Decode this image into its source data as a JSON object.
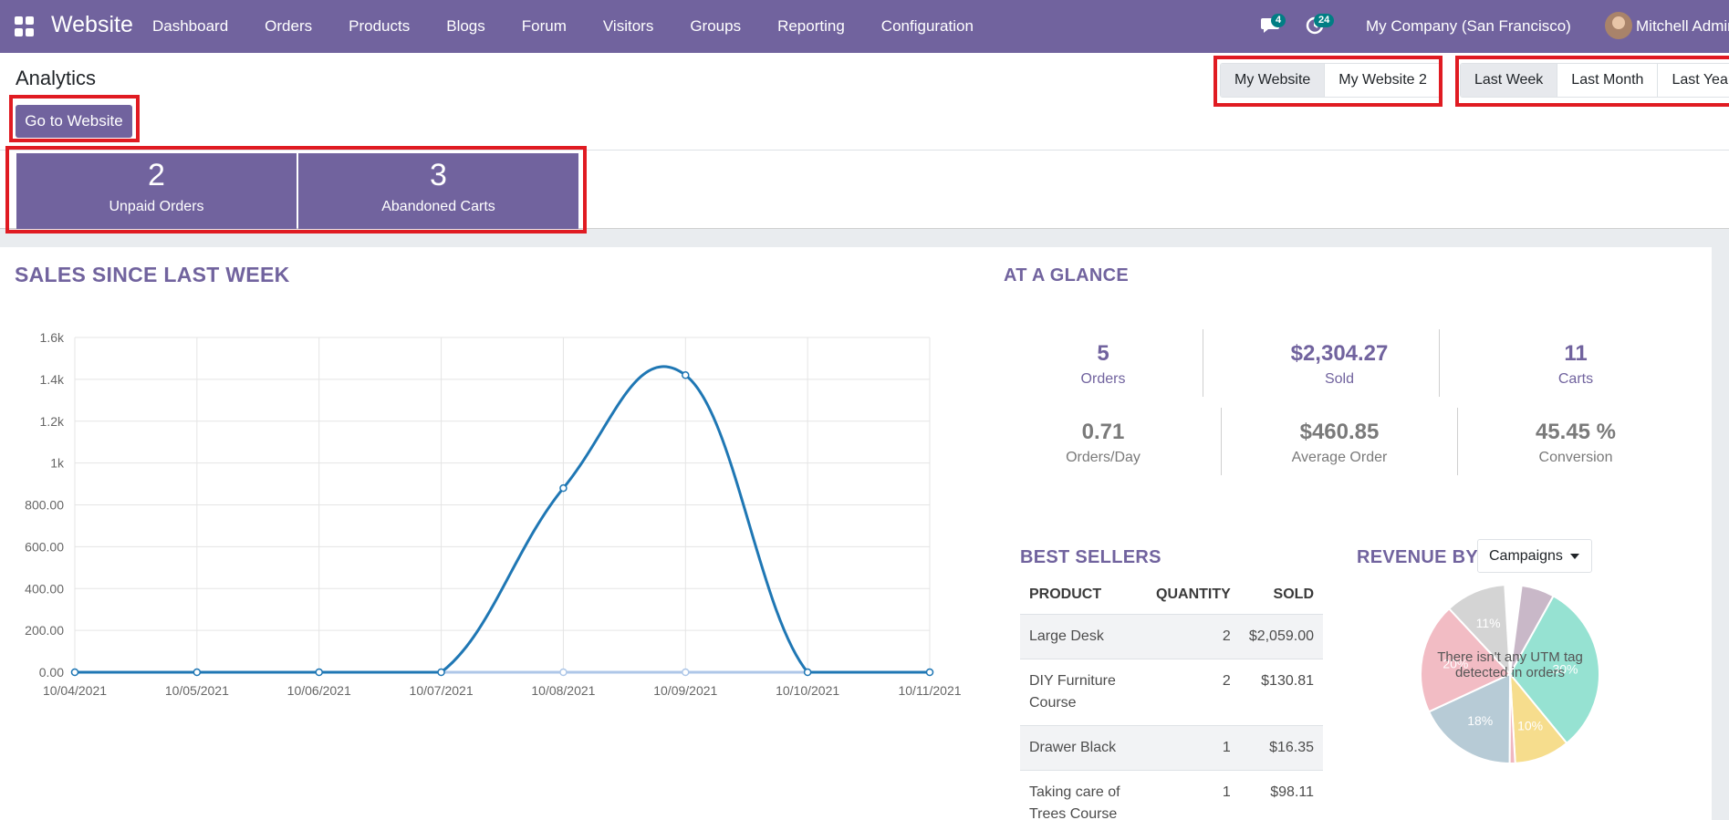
{
  "navbar": {
    "app_title": "Website",
    "menu": [
      "Dashboard",
      "Orders",
      "Products",
      "Blogs",
      "Forum",
      "Visitors",
      "Groups",
      "Reporting",
      "Configuration"
    ],
    "chat_count": "4",
    "activity_count": "24",
    "company": "My Company (San Francisco)",
    "user": "Mitchell Admin"
  },
  "control": {
    "title": "Analytics",
    "go_button": "Go to Website",
    "websites": [
      "My Website",
      "My Website 2"
    ],
    "active_website": "My Website",
    "periods": [
      "Last Week",
      "Last Month",
      "Last Year"
    ],
    "active_period": "Last Week"
  },
  "stats": {
    "unpaid_orders": {
      "value": "2",
      "label": "Unpaid Orders"
    },
    "abandoned_carts": {
      "value": "3",
      "label": "Abandoned Carts"
    }
  },
  "sales": {
    "title": "SALES SINCE LAST WEEK"
  },
  "chart_data": {
    "type": "line",
    "title": "",
    "x": [
      "10/04/2021",
      "10/05/2021",
      "10/06/2021",
      "10/07/2021",
      "10/08/2021",
      "10/09/2021",
      "10/10/2021",
      "10/11/2021"
    ],
    "series": [
      {
        "values": [
          0,
          0,
          0,
          0,
          880,
          1420,
          0,
          0
        ],
        "color": "#1f77b4"
      },
      {
        "values": [
          0,
          0,
          0,
          0,
          0,
          0,
          0,
          0
        ],
        "color": "#aec7e8"
      }
    ],
    "yticks": [
      "0.00",
      "200.00",
      "400.00",
      "600.00",
      "800.00",
      "1k",
      "1.2k",
      "1.4k",
      "1.6k"
    ],
    "ylim": [
      0,
      1600
    ],
    "grid": true
  },
  "glance": {
    "title": "AT A GLANCE",
    "kpis_top": [
      {
        "value": "5",
        "label": "Orders"
      },
      {
        "value": "$2,304.27",
        "label": "Sold"
      },
      {
        "value": "11",
        "label": "Carts"
      }
    ],
    "kpis_bottom": [
      {
        "value": "0.71",
        "label": "Orders/Day"
      },
      {
        "value": "$460.85",
        "label": "Average Order"
      },
      {
        "value": "45.45 %",
        "label": "Conversion"
      }
    ]
  },
  "best_sellers": {
    "title": "BEST SELLERS",
    "columns": [
      "PRODUCT",
      "QUANTITY",
      "SOLD"
    ],
    "rows": [
      [
        "Large Desk",
        "2",
        "$2,059.00"
      ],
      [
        "DIY Furniture Course",
        "2",
        "$130.81"
      ],
      [
        "Drawer Black",
        "1",
        "$16.35"
      ],
      [
        "Taking care of Trees Course",
        "1",
        "$98.11"
      ]
    ]
  },
  "revenue": {
    "title": "REVENUE BY",
    "selected": "Campaigns",
    "message": "There isn't any UTM tag detected in orders",
    "slices": [
      {
        "pct": 6,
        "color": "#c9b8c8",
        "label": ""
      },
      {
        "pct": 31,
        "color": "#96e2d2",
        "label": "30%"
      },
      {
        "pct": 10,
        "color": "#f6dd8d",
        "label": "10%"
      },
      {
        "pct": 1,
        "color": "#f0b7c0",
        "label": ""
      },
      {
        "pct": 18,
        "color": "#b7cbd6",
        "label": "18%"
      },
      {
        "pct": 20,
        "color": "#f2bcc4",
        "label": "20%"
      },
      {
        "pct": 11,
        "color": "#d4d4d4",
        "label": "11%"
      }
    ]
  }
}
